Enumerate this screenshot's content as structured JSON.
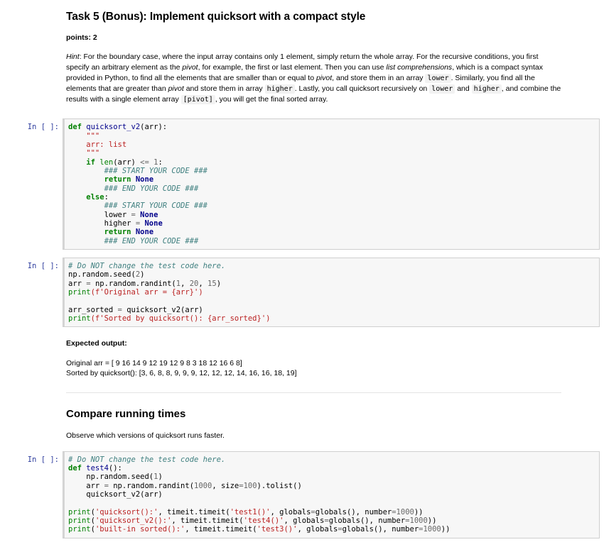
{
  "task": {
    "title": "Task 5 (Bonus): Implement quicksort with a compact style",
    "points": "points: 2",
    "hint_label": "Hint",
    "hint_p1": ": For the boundary case, where the input array contains only 1 element, simply return the whole array. For the recursive conditions, you first specify an arbitrary element as the ",
    "hint_pivot1": "pivot",
    "hint_p2": ", for example, the first or last element. Then you can use ",
    "hint_listcomp": "list comprehensions",
    "hint_p3": ", which is a compact syntax provided in Python, to find all the elements that are smaller than or equal to ",
    "hint_pivot2": "pivot",
    "hint_p4": ", and store them in an array ",
    "chip_lower1": "lower",
    "hint_p5": ". Similarly, you find all the elements that are greater than ",
    "hint_pivot3": "pivot",
    "hint_p6": " and store them in array ",
    "chip_higher1": "higher",
    "hint_p7": ". Lastly, you call quicksort recursively on ",
    "chip_lower2": "lower",
    "hint_p8": " and ",
    "chip_higher2": "higher",
    "hint_p9": ", and combine the results with a single element array ",
    "chip_pivot": "[pivot]",
    "hint_p10": ", you will get the final sorted array."
  },
  "cells": {
    "prompt": "In [ ]:",
    "cell1": {
      "l1_def": "def",
      "l1_name": " quicksort_v2",
      "l1_args": "(arr):",
      "l2_doc": "    \"\"\"",
      "l3_doc": "    arr: list",
      "l4_doc": "    \"\"\"",
      "l5_if": "    if ",
      "l5_len": "len",
      "l5_rest": "(arr) ",
      "l5_op": "<=",
      "l5_num": " 1",
      "l5_colon": ":",
      "l6_c": "        ### START YOUR CODE ###",
      "l7_ret": "        return ",
      "l7_none": "None",
      "l8_c": "        ### END YOUR CODE ###",
      "l9_else": "    else",
      "l9_colon": ":",
      "l10_c": "        ### START YOUR CODE ###",
      "l11_var": "        lower ",
      "l11_op": "=",
      "l11_none": " None",
      "l12_var": "        higher ",
      "l12_op": "=",
      "l12_none": " None",
      "l13_ret": "        return ",
      "l13_none": "None",
      "l14_c": "        ### END YOUR CODE ###"
    },
    "cell2": {
      "l1_c": "# Do NOT change the test code here.",
      "l2_a": "np.random.seed(",
      "l2_n": "2",
      "l2_b": ")",
      "l3_a": "arr ",
      "l3_op": "=",
      "l3_b": " np.random.randint(",
      "l3_n1": "1",
      "l3_c1": ", ",
      "l3_n2": "20",
      "l3_c2": ", ",
      "l3_n3": "15",
      "l3_d": ")",
      "l4_p": "print",
      "l4_s": "(f'Original arr = {arr}')",
      "l6_a": "arr_sorted ",
      "l6_op": "=",
      "l6_b": " quicksort_v2(arr)",
      "l7_p": "print",
      "l7_s": "(f'Sorted by quicksort(): {arr_sorted}')"
    },
    "cell3": {
      "l1_c": "# Do NOT change the test code here.",
      "l2_def": "def",
      "l2_name": " test4",
      "l2_args": "():",
      "l3": "    np.random.seed(",
      "l3_n": "1",
      "l3_b": ")",
      "l4_a": "    arr ",
      "l4_op": "=",
      "l4_b": " np.random.randint(",
      "l4_n1": "1000",
      "l4_c1": ", size",
      "l4_op2": "=",
      "l4_n2": "100",
      "l4_d": ").tolist()",
      "l5": "    quicksort_v2(arr)",
      "l8_p": "print",
      "l8_o": "(",
      "l8_s": "'quicksort():'",
      "l8_m": ", timeit.timeit(",
      "l8_s2": "'test1()'",
      "l8_g": ", globals",
      "l8_eq": "=",
      "l8_g2": "globals(), number",
      "l8_eq2": "=",
      "l8_n": "1000",
      "l8_end": "))",
      "l9_p": "print",
      "l9_o": "(",
      "l9_s": "'quicksort_v2():'",
      "l9_m": ", timeit.timeit(",
      "l9_s2": "'test4()'",
      "l9_g": ", globals",
      "l9_eq": "=",
      "l9_g2": "globals(), number",
      "l9_eq2": "=",
      "l9_n": "1000",
      "l9_end": "))",
      "l10_p": "print",
      "l10_o": "(",
      "l10_s": "'built-in sorted():'",
      "l10_m": ", timeit.timeit(",
      "l10_s2": "'test3()'",
      "l10_g": ", globals",
      "l10_eq": "=",
      "l10_g2": "globals(), number",
      "l10_eq2": "=",
      "l10_n": "1000",
      "l10_end": "))"
    }
  },
  "expected": {
    "label": "Expected output:",
    "line1": "Original arr = [ 9 16 14 9 12 19 12 9 8 3 18 12 16 6 8]",
    "line2": "Sorted by quicksort(): [3, 6, 8, 8, 9, 9, 9, 12, 12, 12, 14, 16, 16, 18, 19]"
  },
  "compare": {
    "title": "Compare running times",
    "desc": "Observe which versions of quicksort runs faster."
  },
  "colors": {
    "keyword": "#008000",
    "function": "#00008B",
    "comment": "#408080",
    "string": "#BA2121",
    "prompt": "#303f9f",
    "cell_bg": "#f7f7f7"
  }
}
